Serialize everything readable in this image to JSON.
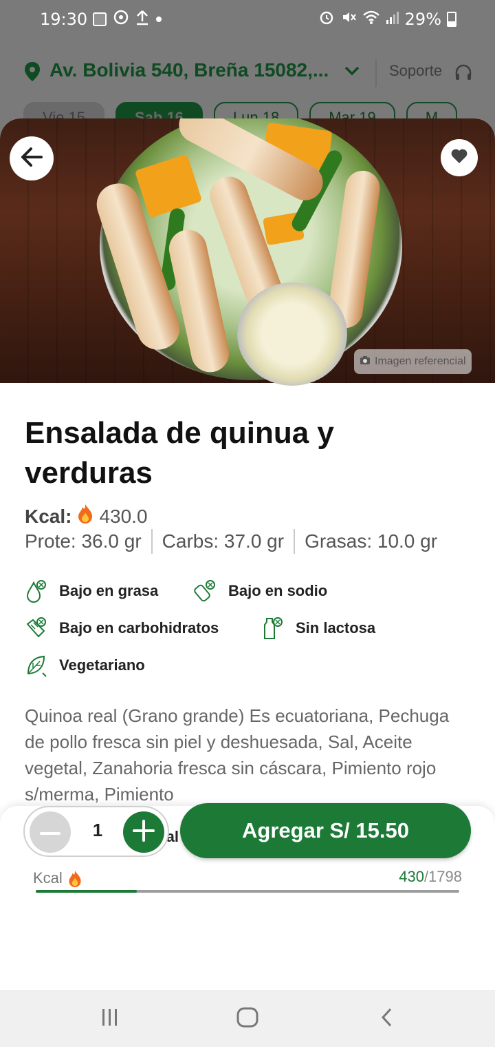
{
  "status_bar": {
    "time": "19:30",
    "battery": "29%"
  },
  "header": {
    "address": "Av. Bolivia 540, Breña 15082,...",
    "support_label": "Soporte"
  },
  "date_tabs": [
    {
      "label": "Vie 15",
      "state": "disabled"
    },
    {
      "label": "Sab 16",
      "state": "active"
    },
    {
      "label": "Lun 18",
      "state": "normal"
    },
    {
      "label": "Mar 19",
      "state": "normal"
    },
    {
      "label": "M",
      "state": "normal"
    }
  ],
  "hero": {
    "badge_label": "Imagen referencial"
  },
  "product": {
    "title": "Ensalada de quinua y verduras",
    "kcal_label": "Kcal:",
    "kcal_value": "430.0",
    "macros": {
      "protein": "Prote: 36.0 gr",
      "carbs": "Carbs: 37.0 gr",
      "fat": "Grasas: 10.0 gr"
    },
    "tags": [
      {
        "label": "Bajo en grasa",
        "icon": "low-fat-icon"
      },
      {
        "label": "Bajo en sodio",
        "icon": "low-sodium-icon"
      },
      {
        "label": "Bajo en carbohidratos",
        "icon": "low-carbs-icon"
      },
      {
        "label": "Sin lactosa",
        "icon": "lactose-free-icon"
      },
      {
        "label": "Vegetariano",
        "icon": "vegetarian-icon"
      }
    ],
    "description": "Quinoa real (Grano grande) Es ecuatoriana, Pechuga de pollo fresca sin piel y deshuesada, Sal, Aceite vegetal, Zanahoria fresca sin cáscara, Pimiento rojo s/merma, Pimiento"
  },
  "nutrition": {
    "title": "Info. nutricional de tu pedido",
    "kcal_label": "Kcal",
    "current": "430",
    "total": "/1798",
    "progress_fraction": 0.239
  },
  "order": {
    "quantity": "1",
    "add_label": "Agregar S/ 15.50"
  },
  "colors": {
    "brand_green": "#1c7a36",
    "dark_green": "#0f4a22"
  }
}
